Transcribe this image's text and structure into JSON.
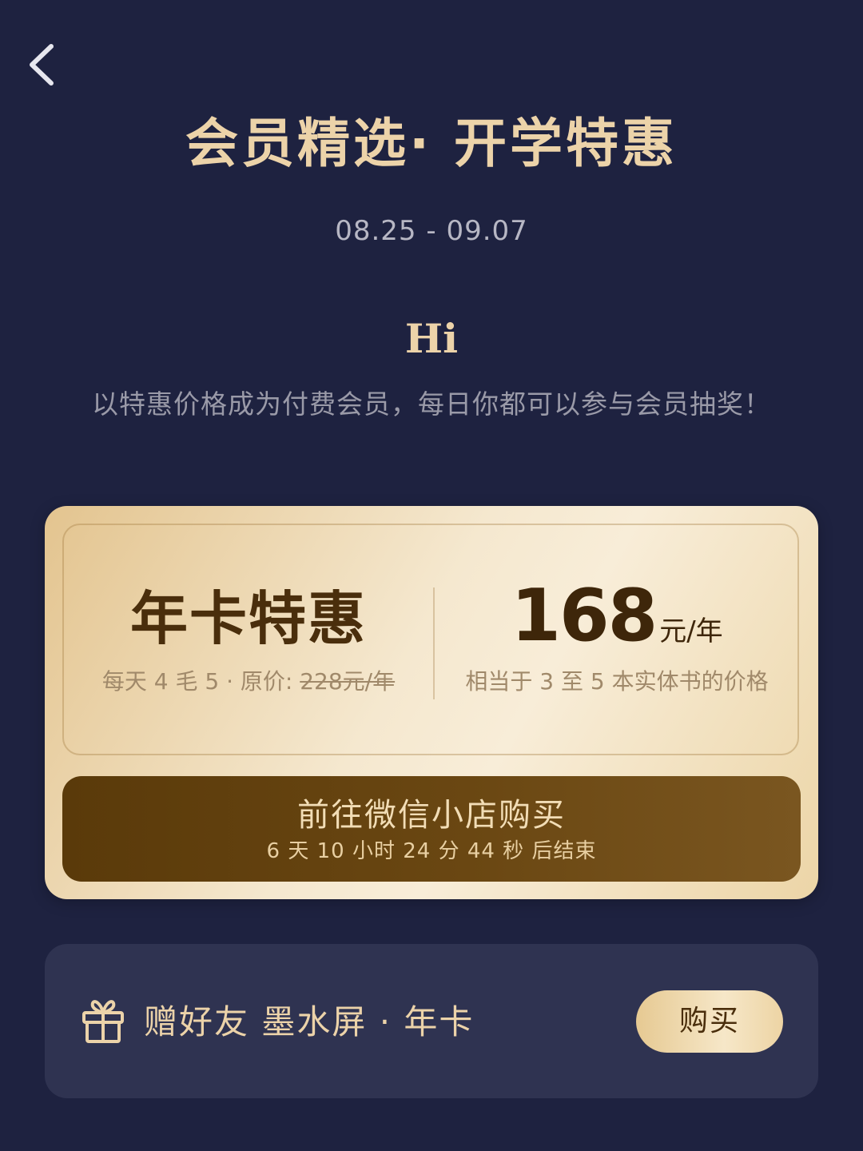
{
  "header": {
    "back_icon": "chevron-left-icon",
    "title": "会员精选· 开学特惠",
    "date_range": "08.25 - 09.07"
  },
  "intro": {
    "greeting": "Hi",
    "subtitle": "以特惠价格成为付费会员，每日你都可以参与会员抽奖！"
  },
  "promo": {
    "card_name": "年卡特惠",
    "note_prefix": "每天 4 毛 5 · 原价: ",
    "original_price": "228元/年",
    "price": "168",
    "price_unit": "元/年",
    "price_note": "相当于 3 至 5 本实体书的价格",
    "buy_label": "前往微信小店购买",
    "countdown": "6 天 10 小时 24 分 44 秒 后结束"
  },
  "gift": {
    "icon": "gift-icon",
    "label": "赠好友 墨水屏 · 年卡",
    "buy_label": "购买"
  },
  "colors": {
    "background": "#1e2240",
    "gold_text": "#ecd3a9",
    "button_brown": "#5a3a0a",
    "gift_panel": "#2f3351"
  }
}
